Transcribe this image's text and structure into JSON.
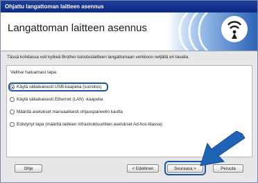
{
  "window": {
    "title": "Ohjattu langattoman laitteen asennus"
  },
  "header": {
    "title": "Langattoman laitteen asennus"
  },
  "main": {
    "description": "Tässä kohdassa voit kytkeä Brother-tulostuslaitteen langattomaan verkkoon neljällä eri tavalla.",
    "prompt": "Valitse haluamasi tapa:",
    "options": [
      {
        "label": "Käytä väliaikaisesti USB-kaapelia (suositus)",
        "selected": true
      },
      {
        "label": "Käytä väliaikaisesti Ethernet (LAN) -kaapelia",
        "selected": false
      },
      {
        "label": "Määritä asetukset manuaalisesti ohjauspaneelin kautta",
        "selected": false
      },
      {
        "label": "Edistynyt tapa (määritä laitteen infrastruktuuritilan asetukset Ad-hoc-tilassa)",
        "selected": false
      }
    ]
  },
  "footer": {
    "help_label": "Ohje",
    "back_label": "< Edellinen",
    "next_label": "Seuraava >",
    "cancel_label": "Peruuta"
  },
  "colors": {
    "accent": "#1a56a8",
    "titlebar": "#0b2a86",
    "arrow": "#1e63b5"
  },
  "icons": {
    "banner": "wireless-signal-icon",
    "pointer": "arrow-pointer-icon"
  }
}
